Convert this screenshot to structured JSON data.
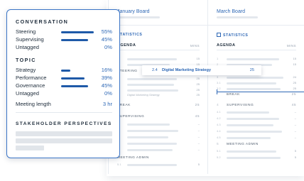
{
  "boards": {
    "jan": {
      "title": "January Board",
      "statistics": "STATISTICS",
      "agenda": "AGENDA",
      "mins": "MINS",
      "rows1": [
        {
          "num": "",
          "value": "15"
        },
        {
          "num": "",
          "value": "15"
        },
        {
          "num": "",
          "value": "25"
        },
        {
          "num": "",
          "value": "25"
        },
        {
          "num": "",
          "value": "25"
        },
        {
          "num": "",
          "value": "25"
        }
      ],
      "sub_note": "Digital Marketing Strategy",
      "steering": "STEERING",
      "break": "BREAK",
      "break_value": "25",
      "supervising": "SUPERVISING",
      "supervising_value": "45",
      "dashes": [
        "–",
        "–",
        "–",
        "–",
        "–"
      ],
      "meeting_admin": "MEETING ADMIN",
      "last_num": "5.1",
      "last_value": "5"
    },
    "mar": {
      "title": "March Board",
      "statistics": "STATISTICS",
      "agenda": "AGENDA",
      "mins": "MINS",
      "rows1": [
        {
          "num": "1",
          "value": "15"
        },
        {
          "num": "2",
          "value": "15"
        },
        {
          "num": "3",
          "value": "24"
        },
        {
          "num": "3.1",
          "value": "25"
        },
        {
          "num": "3.2",
          "value": "25"
        }
      ],
      "break": "BREAK",
      "break_num": "",
      "break_value": "25",
      "supervising": "SUPERVISING",
      "supervising_num": "4",
      "supervising_value": "45",
      "subs": [
        {
          "num": "4.1",
          "value": "–"
        },
        {
          "num": "4.2",
          "value": "–"
        },
        {
          "num": "4.3",
          "value": "–"
        },
        {
          "num": "4.4",
          "value": "–"
        },
        {
          "num": "4.5",
          "value": "–"
        }
      ],
      "meeting_admin": "MEETING ADMIN",
      "meeting_admin_num": "5",
      "admin_rows": [
        {
          "num": "5.1",
          "value": "5"
        },
        {
          "num": "5.2",
          "value": "5"
        }
      ]
    }
  },
  "drag_item": {
    "num": "2.4",
    "title": "Digital Marketing Strategy",
    "minutes": "25"
  },
  "panel": {
    "conversation_title": "CONVERSATION",
    "conversation": [
      {
        "label": "Steering",
        "percent": "55%",
        "fraction": 0.55
      },
      {
        "label": "Supervising",
        "percent": "45%",
        "fraction": 0.45
      },
      {
        "label": "Untagged",
        "percent": "0%",
        "fraction": 0
      }
    ],
    "topic_title": "TOPIC",
    "topic": [
      {
        "label": "Strategy",
        "percent": "16%",
        "fraction": 0.16
      },
      {
        "label": "Performance",
        "percent": "39%",
        "fraction": 0.39
      },
      {
        "label": "Governance",
        "percent": "45%",
        "fraction": 0.45
      },
      {
        "label": "Untagged",
        "percent": "0%",
        "fraction": 0
      }
    ],
    "meeting_length_label": "Meeting length",
    "meeting_length_value": "3 hr",
    "stakeholder_title": "STAKEHOLDER PERSPECTIVES"
  },
  "colors": {
    "accent": "#2d67b5",
    "bar": "#1f5aa8",
    "panel_border": "#3a74c6"
  }
}
